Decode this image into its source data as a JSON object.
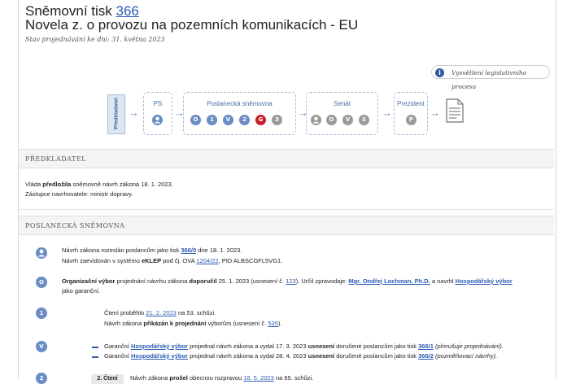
{
  "header": {
    "title_prefix": "Sněmovní tisk",
    "title_number": "366",
    "subtitle": "Novela z. o provozu na pozemních komunikacích - EU",
    "status": "Stav projednávání ke dni: 31. května 2023",
    "legis_button": "Vysvětlení legislativního procesu"
  },
  "flow": {
    "predkladatel": "Předkladatel",
    "ps_label": "PS",
    "ps_icon": "person-icon",
    "snemovna_label": "Poslanecká sněmovna",
    "snemovna_steps": [
      {
        "label": "O",
        "color": "#6b8cc4"
      },
      {
        "label": "1",
        "color": "#6b8cc4"
      },
      {
        "label": "V",
        "color": "#6b8cc4"
      },
      {
        "label": "2",
        "color": "#6b8cc4"
      },
      {
        "label": "G",
        "color": "#c8202b"
      },
      {
        "label": "3",
        "color": "#9a9a9a"
      }
    ],
    "senat_label": "Senát",
    "senat_steps": [
      {
        "label": "O",
        "color": "#9a9a9a"
      },
      {
        "label": "V",
        "color": "#9a9a9a"
      },
      {
        "label": "S",
        "color": "#9a9a9a"
      }
    ],
    "senat_icon": "person-icon",
    "prezident_label": "Prezident",
    "prezident_step": "P",
    "document_icon": "document-icon"
  },
  "predkladatel_section": {
    "heading": "PŘEDKLADATEL",
    "line1_a": "Vláda",
    "line1_b": "předložila",
    "line1_c": "sněmovně návrh zákona 18. 1. 2023.",
    "line2": "Zástupce navrhovatele: ministr dopravy."
  },
  "snemovna_section": {
    "heading": "POSLANECKÁ SNĚMOVNA",
    "entries": {
      "e1_l1_a": "Návrh zákona rozeslán poslancům jako tisk",
      "e1_l1_link": "366/0",
      "e1_l1_b": "dne 18. 1. 2023.",
      "e1_l2_a": "Návrh zaevidován v systému",
      "e1_l2_b": "eKLEP",
      "e1_l2_c": "pod čj. OVA",
      "e1_l2_link": "1204/22",
      "e1_l2_d": ", PID ALBSCGFL5VG1.",
      "e2_a": "Organizační výbor",
      "e2_b": "projednání návrhu zákona",
      "e2_c": "doporučil",
      "e2_d": "25. 1. 2023 (usnesení č.",
      "e2_link": "123",
      "e2_e": "). Určil zpravodaje:",
      "e2_person": "Mgr. Ondřej Lochman, Ph.D.",
      "e2_f": "a navrhl",
      "e2_committee": "Hospodářský výbor",
      "e2_l2": "jako garanční.",
      "e3_l1_a": "Čtení proběhlo",
      "e3_l1_link": "21. 2. 2023",
      "e3_l1_b": "na 53. schůzi.",
      "e3_l2_a": "Návrh zákona",
      "e3_l2_b": "přikázán k projednání",
      "e3_l2_c": "výborům (usnesení č.",
      "e3_l2_link": "535",
      "e3_l2_d": ").",
      "e4_l1_a": "Garanční",
      "e4_l1_link": "Hospodářský výbor",
      "e4_l1_b": "projednal návrh zákona a vydal 17. 3. 2023",
      "e4_l1_c": "usnesení",
      "e4_l1_d": "doručené poslancům jako tisk",
      "e4_l1_link2": "366/1",
      "e4_l1_e": "(přerušuje projednávání).",
      "e4_l2_a": "Garanční",
      "e4_l2_link": "Hospodářský výbor",
      "e4_l2_b": "projednal návrh zákona a vydal 28. 4. 2023",
      "e4_l2_c": "usnesení",
      "e4_l2_d": "doručené poslancům jako tisk",
      "e4_l2_link2": "366/2",
      "e4_l2_e": "(pozměňovací návrhy).",
      "e5_badge": "2. Čtení",
      "e5_a": "Návrh zákona",
      "e5_b": "prošel",
      "e5_c": "obecnou rozpravou",
      "e5_link": "18. 5. 2023",
      "e5_d": "na 65. schůzi."
    },
    "icons": [
      "person-icon",
      "O",
      "1",
      "V",
      "2"
    ]
  }
}
